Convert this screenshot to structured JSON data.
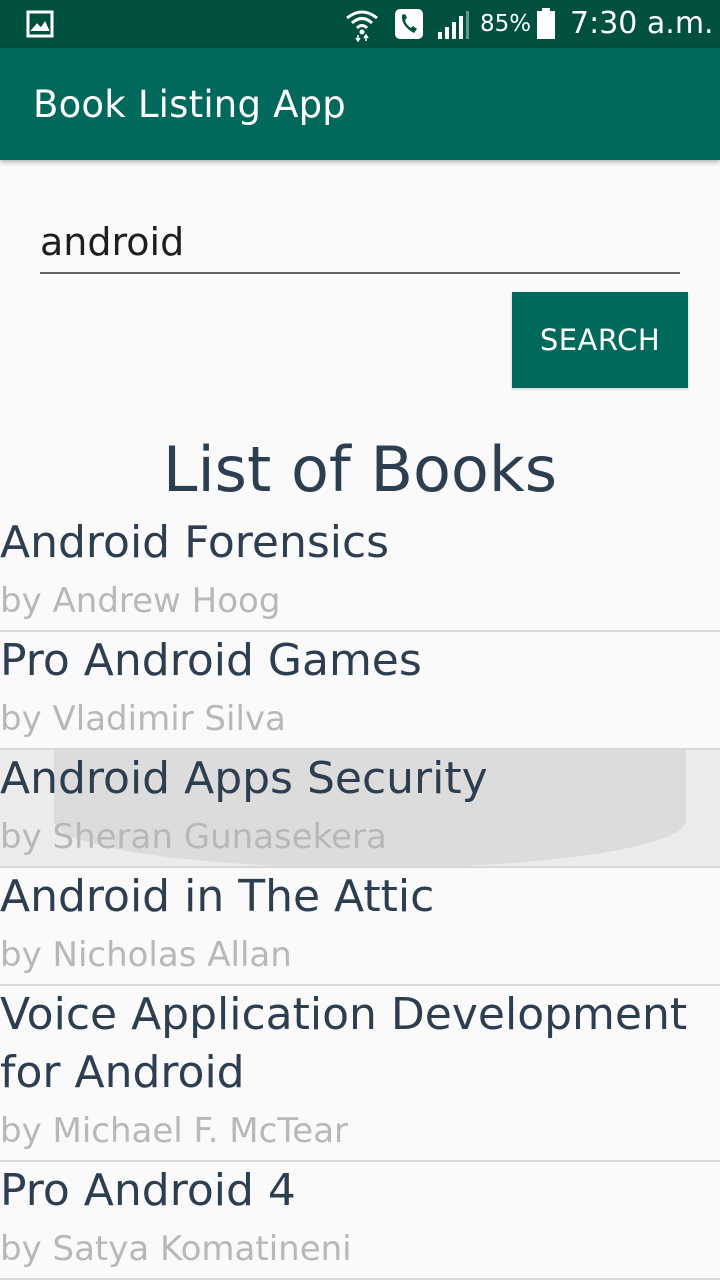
{
  "status_bar": {
    "battery_percent": "85%",
    "time": "7:30 a.m.",
    "icons": [
      "gallery-icon",
      "wifi-icon",
      "call-icon",
      "signal-icon",
      "battery-icon"
    ]
  },
  "app_bar": {
    "title": "Book Listing App",
    "color": "#00695c"
  },
  "search": {
    "value": "android",
    "button_label": "SEARCH"
  },
  "list_heading": "List of Books",
  "books": [
    {
      "title": "Android Forensics",
      "author": "by Andrew Hoog"
    },
    {
      "title": "Pro Android Games",
      "author": "by Vladimir Silva"
    },
    {
      "title": "Android Apps Security",
      "author": "by Sheran Gunasekera"
    },
    {
      "title": "Android in The Attic",
      "author": "by Nicholas Allan"
    },
    {
      "title": "Voice Application Development for Android",
      "author": "by Michael F. McTear"
    },
    {
      "title": "Pro Android 4",
      "author": "by Satya Komatineni"
    }
  ]
}
